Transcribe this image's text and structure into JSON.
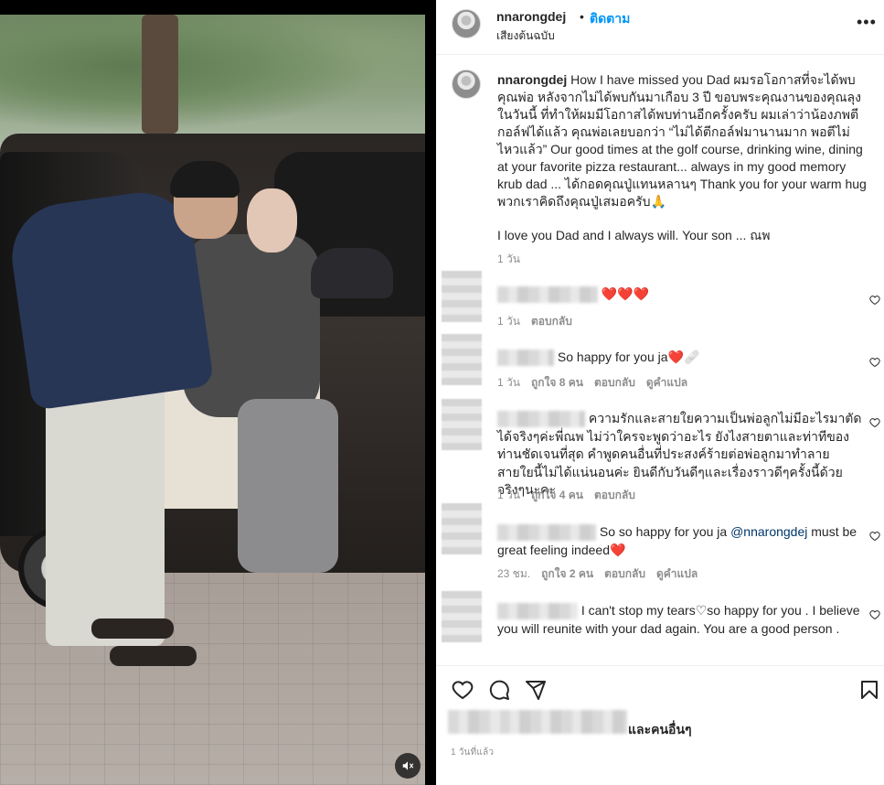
{
  "media": {
    "alt_label": "",
    "mute_icon": "speaker-muted-icon"
  },
  "header": {
    "username": "nnarongdej",
    "separator": "•",
    "follow_label": "ติดตาม",
    "audio_label": "เสียงต้นฉบับ",
    "more_label": "•••"
  },
  "caption": {
    "username": "nnarongdej",
    "text": "How I have missed you Dad ผมรอโอกาสที่จะได้พบคุณพ่อ หลังจากไม่ได้พบกันมาเกือบ 3 ปี ขอบพระคุณงานของคุณลุงในวันนี้ ที่ทำให้ผมมีโอกาสได้พบท่านอีกครั้งครับ ผมเล่าว่าน้องภพตีกอล์ฟได้แล้ว คุณพ่อเลยบอกว่า “ไม่ได้ตีกอล์ฟมานานมาก พอตีไม่ไหวแล้ว” Our good times at the golf course, drinking wine, dining at your favorite pizza restaurant... always in my good memory krub dad ... ได้กอดคุณปู่แทนหลานๆ Thank you for your warm hug พวกเราคิดถึงคุณปู่เสมอครับ🙏",
    "text2": "I love you Dad and I always will. Your son ... ณพ",
    "time": "1 วัน"
  },
  "comments": [
    {
      "text": "❤️❤️❤️",
      "time": "1 วัน",
      "likes": "",
      "reply": "ตอบกลับ",
      "translate": ""
    },
    {
      "text": "So happy for you ja❤️🩹",
      "time": "1 วัน",
      "likes": "ถูกใจ 8 คน",
      "reply": "ตอบกลับ",
      "translate": "ดูคำแปล"
    },
    {
      "text": "ความรักและสายใยความเป็นพ่อลูกไม่มีอะไรมาตัดได้จริงๆค่ะพี่ณพ ไม่ว่าใครจะพูดว่าอะไร ยังไงสายตาและท่าทีของท่านชัดเจนที่สุด คำพูดคนอื่นที่ประสงค์ร้ายต่อพ่อลูกมาทำลายสายใยนี้ไม่ได้แน่นอนค่ะ ยินดีกับวันดีๆและเรื่องราวดีๆครั้งนี้ด้วยจริงๆนะคะ",
      "time": "1 วัน",
      "likes": "ถูกใจ 4 คน",
      "reply": "ตอบกลับ",
      "translate": ""
    },
    {
      "text_before": "So so happy for you ja ",
      "mention": "@nnarongdej",
      "text_after": " must be great feeling indeed❤️",
      "time": "23 ชม.",
      "likes": "ถูกใจ 2 คน",
      "reply": "ตอบกลับ",
      "translate": "ดูคำแปล"
    },
    {
      "text": "I can't stop my tears♡so happy for you . I believe you will reunite with your dad again. You are a good person ."
    }
  ],
  "actions": {
    "like_icon": "heart-icon",
    "comment_icon": "comment-icon",
    "share_icon": "share-icon",
    "save_icon": "bookmark-icon",
    "likes_suffix": "และคนอื่นๆ",
    "post_time": "1 วันที่แล้ว"
  }
}
